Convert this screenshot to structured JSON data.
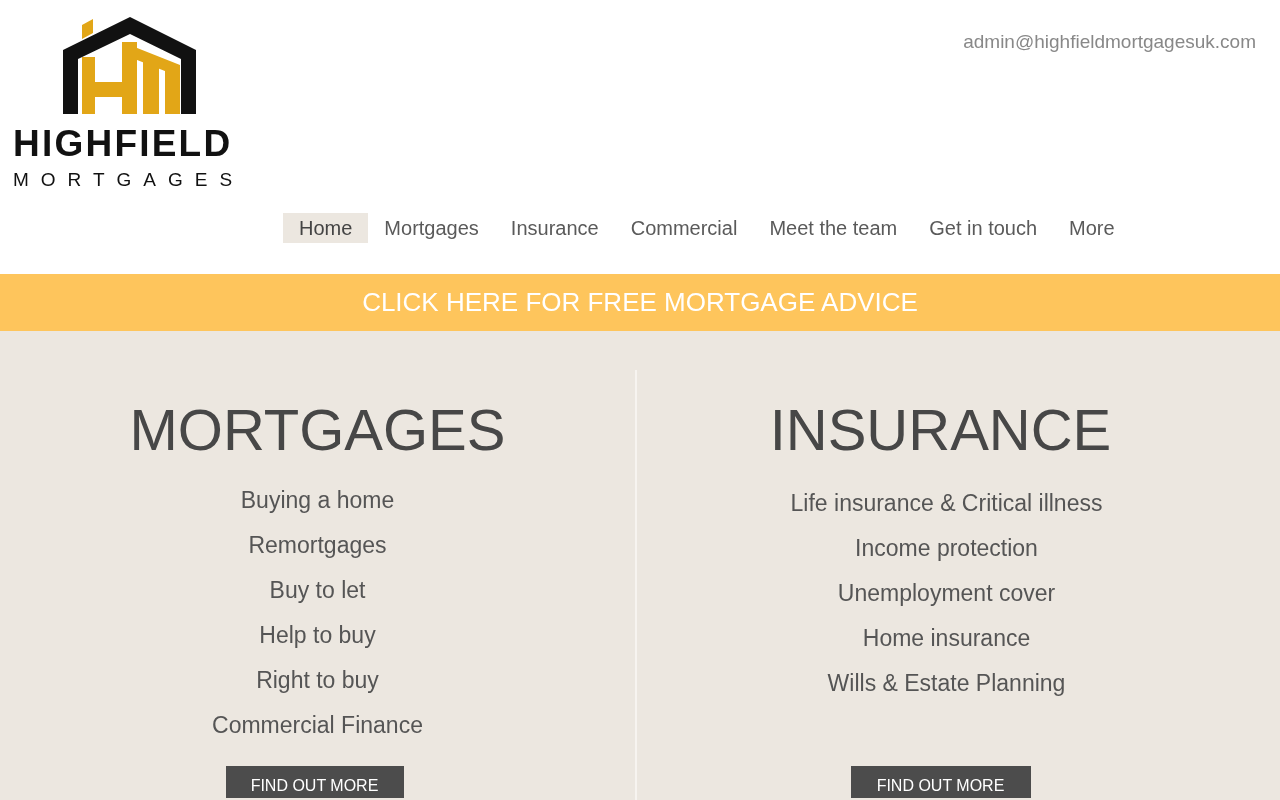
{
  "logo": {
    "name": "HIGHFIELD",
    "tagline": "MORTGAGES"
  },
  "header": {
    "email": "admin@highfieldmortgagesuk.com"
  },
  "nav": [
    {
      "label": "Home",
      "selected": true
    },
    {
      "label": "Mortgages",
      "selected": false
    },
    {
      "label": "Insurance",
      "selected": false
    },
    {
      "label": "Commercial",
      "selected": false
    },
    {
      "label": "Meet the team",
      "selected": false
    },
    {
      "label": "Get in touch",
      "selected": false
    },
    {
      "label": "More",
      "selected": false
    }
  ],
  "banner": {
    "text": "CLICK HERE FOR FREE MORTGAGE ADVICE"
  },
  "sections": [
    {
      "title": "MORTGAGES",
      "items": [
        "Buying a home",
        "Remortgages",
        "Buy to let",
        "Help to buy",
        "Right to buy",
        "Commercial Finance"
      ],
      "button": "FIND OUT MORE"
    },
    {
      "title": "INSURANCE",
      "items": [
        "Life insurance & Critical illness",
        "Income protection",
        "Unemployment cover",
        "Home insurance",
        "Wills & Estate Planning"
      ],
      "button": "FIND OUT MORE"
    }
  ]
}
